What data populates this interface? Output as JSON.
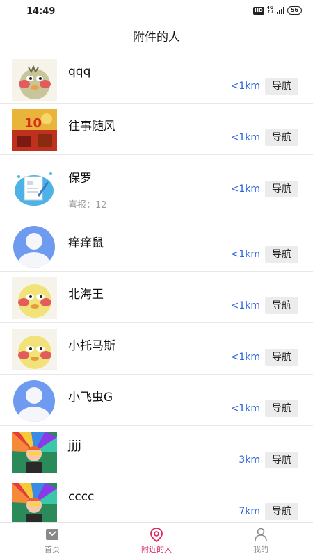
{
  "status_bar": {
    "time": "14:49",
    "hd": "HD",
    "net": "4G",
    "battery": "56"
  },
  "header": {
    "title": "附件的人"
  },
  "list": {
    "items": [
      {
        "name": "qqq",
        "subtitle": "",
        "distance": "<1km",
        "nav_label": "导航",
        "avatar": "duck-avatar"
      },
      {
        "name": "往事随风",
        "subtitle": "",
        "distance": "<1km",
        "nav_label": "导航",
        "avatar": "celebration-avatar"
      },
      {
        "name": "保罗",
        "subtitle": "喜报：12",
        "distance": "<1km",
        "nav_label": "导航",
        "avatar": "document-avatar"
      },
      {
        "name": "痒痒鼠",
        "subtitle": "",
        "distance": "<1km",
        "nav_label": "导航",
        "avatar": "default-avatar"
      },
      {
        "name": "北海王",
        "subtitle": "",
        "distance": "<1km",
        "nav_label": "导航",
        "avatar": "duck-avatar"
      },
      {
        "name": "小托马斯",
        "subtitle": "",
        "distance": "<1km",
        "nav_label": "导航",
        "avatar": "duck-avatar"
      },
      {
        "name": "小飞虫G",
        "subtitle": "",
        "distance": "<1km",
        "nav_label": "导航",
        "avatar": "default-avatar"
      },
      {
        "name": "jjjj",
        "subtitle": "",
        "distance": "3km",
        "nav_label": "导航",
        "avatar": "umbrella-avatar"
      },
      {
        "name": "cccc",
        "subtitle": "",
        "distance": "7km",
        "nav_label": "导航",
        "avatar": "umbrella-avatar"
      }
    ]
  },
  "tabbar": {
    "tabs": [
      {
        "label": "首页",
        "icon": "mail-icon",
        "active": false
      },
      {
        "label": "附近的人",
        "icon": "location-pin-icon",
        "active": true
      },
      {
        "label": "我的",
        "icon": "person-icon",
        "active": false
      }
    ]
  },
  "colors": {
    "accent": "#e0245e",
    "distance": "#2a63e0",
    "nav_button_bg": "#ececec"
  }
}
